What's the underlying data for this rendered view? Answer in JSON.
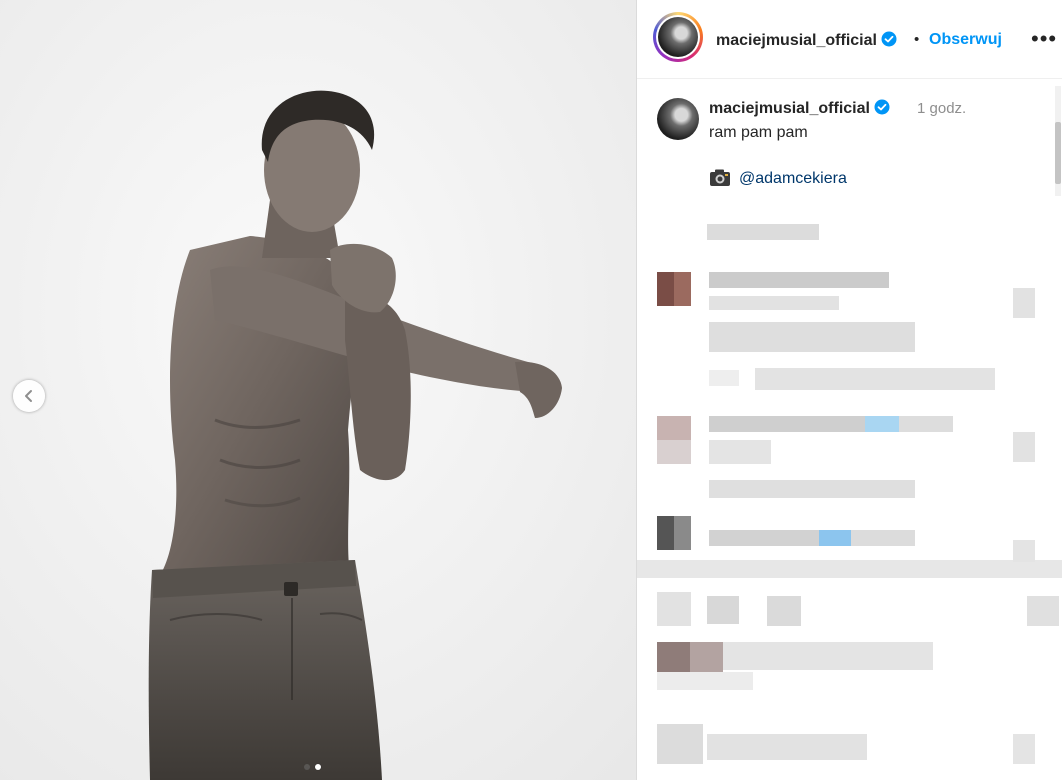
{
  "post": {
    "username": "maciejmusial_official",
    "separator": "•",
    "follow_label": "Obserwuj",
    "more_label": "•••",
    "caption": {
      "username": "maciejmusial_official",
      "time": "1 godz.",
      "text": "ram pam pam",
      "photo_credit": "@adamcekiera"
    }
  },
  "carousel": {
    "slide_count": 2,
    "active_slide": 2
  },
  "icons": {
    "verified": "verified-badge-icon",
    "camera": "camera-icon",
    "previous": "chevron-left-icon"
  },
  "colors": {
    "link_blue": "#0095f6",
    "verified_blue": "#0095f6",
    "tag_color": "#00376b",
    "muted": "#8e8e8e"
  }
}
